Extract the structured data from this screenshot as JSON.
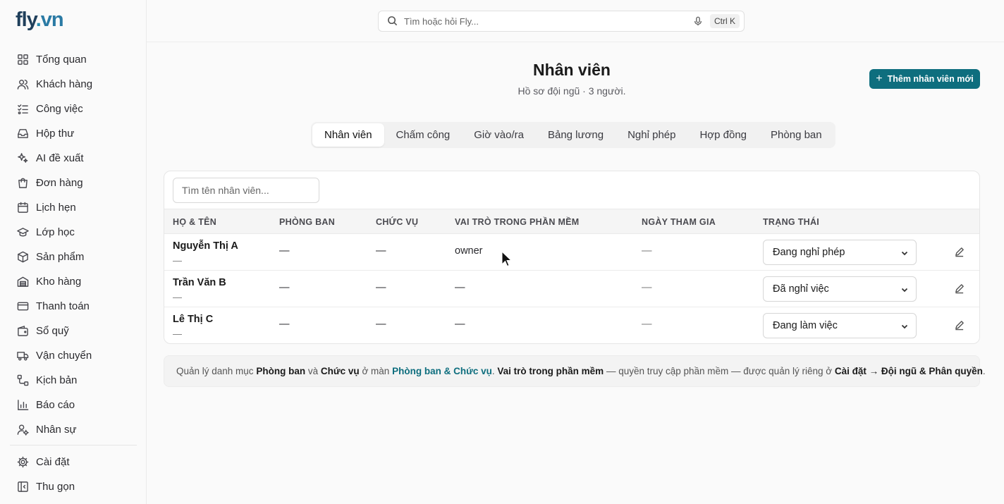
{
  "brand": {
    "name_part1": "fly",
    "dot": ".",
    "name_part2": "vn"
  },
  "sidebar": {
    "items": [
      {
        "label": "Tổng quan",
        "icon": "grid-icon"
      },
      {
        "label": "Khách hàng",
        "icon": "users-icon"
      },
      {
        "label": "Công việc",
        "icon": "tasks-icon"
      },
      {
        "label": "Hộp thư",
        "icon": "inbox-icon"
      },
      {
        "label": "AI đề xuất",
        "icon": "sparkles-icon"
      },
      {
        "label": "Đơn hàng",
        "icon": "shopping-bag-icon"
      },
      {
        "label": "Lịch hẹn",
        "icon": "calendar-icon"
      },
      {
        "label": "Lớp học",
        "icon": "graduation-cap-icon"
      },
      {
        "label": "Sản phẩm",
        "icon": "package-icon"
      },
      {
        "label": "Kho hàng",
        "icon": "warehouse-icon"
      },
      {
        "label": "Thanh toán",
        "icon": "credit-card-icon"
      },
      {
        "label": "Sổ quỹ",
        "icon": "wallet-icon"
      },
      {
        "label": "Vận chuyển",
        "icon": "truck-icon"
      },
      {
        "label": "Kịch bản",
        "icon": "workflow-icon"
      },
      {
        "label": "Báo cáo",
        "icon": "bar-chart-icon"
      },
      {
        "label": "Nhân sự",
        "icon": "user-cog-icon"
      }
    ],
    "bottom": [
      {
        "label": "Cài đặt",
        "icon": "gear-icon"
      },
      {
        "label": "Thu gọn",
        "icon": "collapse-icon"
      }
    ]
  },
  "search": {
    "placeholder": "Tìm hoặc hỏi Fly...",
    "shortcut": "Ctrl K"
  },
  "header": {
    "title": "Nhân viên",
    "subtitle": "Hồ sơ đội ngũ · 3 người.",
    "add_button": "Thêm nhân viên mới",
    "add_button_icon": "+"
  },
  "tabs": [
    {
      "label": "Nhân viên",
      "active": true
    },
    {
      "label": "Chấm công",
      "active": false
    },
    {
      "label": "Giờ vào/ra",
      "active": false
    },
    {
      "label": "Bảng lương",
      "active": false
    },
    {
      "label": "Nghỉ phép",
      "active": false
    },
    {
      "label": "Hợp đồng",
      "active": false
    },
    {
      "label": "Phòng ban",
      "active": false
    }
  ],
  "table": {
    "search_placeholder": "Tìm tên nhân viên...",
    "columns": [
      "HỌ & TÊN",
      "PHÒNG BAN",
      "CHỨC VỤ",
      "VAI TRÒ TRONG PHẦN MỀM",
      "NGÀY THAM GIA",
      "TRẠNG THÁI"
    ],
    "rows": [
      {
        "name": "Nguyễn Thị A",
        "sub": "—",
        "department": "—",
        "position": "—",
        "role": "owner",
        "joined": "—",
        "status": "Đang nghỉ phép"
      },
      {
        "name": "Trần Văn B",
        "sub": "—",
        "department": "—",
        "position": "—",
        "role": "—",
        "joined": "—",
        "status": "Đã nghỉ việc"
      },
      {
        "name": "Lê Thị C",
        "sub": "—",
        "department": "—",
        "position": "—",
        "role": "—",
        "joined": "—",
        "status": "Đang làm việc"
      }
    ]
  },
  "note": {
    "t1": "Quản lý danh mục ",
    "b1": "Phòng ban",
    "t2": " và ",
    "b2": "Chức vụ",
    "t3": " ở màn ",
    "link": "Phòng ban & Chức vụ",
    "t4": ". ",
    "b3": "Vai trò trong phần mềm",
    "t5": " — quyền truy cập phần mềm — được quản lý riêng ở ",
    "b4": "Cài đặt → Đội ngũ & Phân quyền",
    "t6": "."
  },
  "colors": {
    "accent": "#0e6e7e",
    "brand_dark": "#1f3f5b",
    "brand_light": "#2a7aa4"
  }
}
